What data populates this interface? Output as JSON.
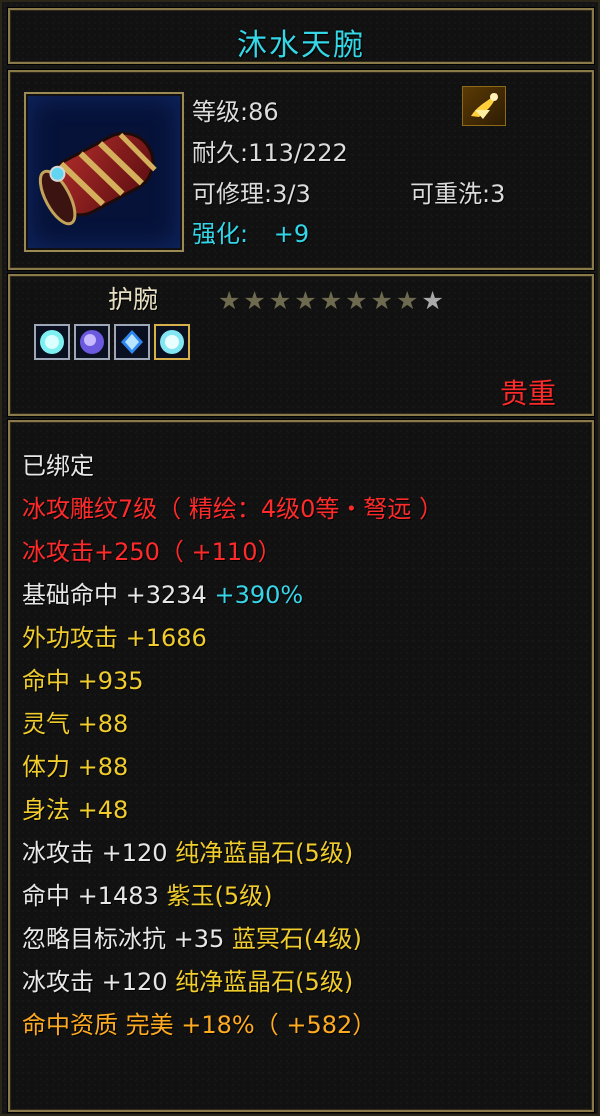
{
  "item": {
    "name": "沐水天腕",
    "level": "等级:86",
    "durability": "耐久:113/222",
    "repairable": "可修理:3/3",
    "rewashable": "可重洗:3",
    "enhance_label": "强化:",
    "enhance_value": "+9",
    "type": "护腕",
    "stars_total": 9,
    "stars_filled": 8,
    "quality": "贵重",
    "gem_icons": [
      "ice-crystal-gem-icon",
      "purple-jade-gem-icon",
      "blue-crystal-gem-icon",
      "ice-crystal-gem-gold-icon"
    ]
  },
  "attributes": {
    "bound": "已绑定",
    "engrave": "冰攻雕纹7级（ 精绘：4级0等・弩远 ）",
    "ice_attack": "冰攻击+250（ +110）",
    "base_hit_label": "基础命中 +3234",
    "base_hit_pct": "+390%",
    "outer_attack": "外功攻击 +1686",
    "hit": "命中 +935",
    "spirit": "灵气 +88",
    "stamina": "体力 +88",
    "agility": "身法 +48",
    "gem_line_1_stat": "冰攻击 +120",
    "gem_line_1_name": "纯净蓝晶石(5级)",
    "gem_line_2_stat": "命中 +1483",
    "gem_line_2_name": "紫玉(5级)",
    "gem_line_3_stat": "忽略目标冰抗 +35",
    "gem_line_3_name": "蓝冥石(4级)",
    "gem_line_4_stat": "冰攻击 +120",
    "gem_line_4_name": "纯净蓝晶石(5级)",
    "aptitude": "命中资质   完美 +18%（ +582）"
  },
  "colors": {
    "cyan": "#38d5e8",
    "red": "#ff2b2b",
    "yellow": "#f0cc2d",
    "orange": "#ffab22",
    "white": "#e7e7e7"
  }
}
